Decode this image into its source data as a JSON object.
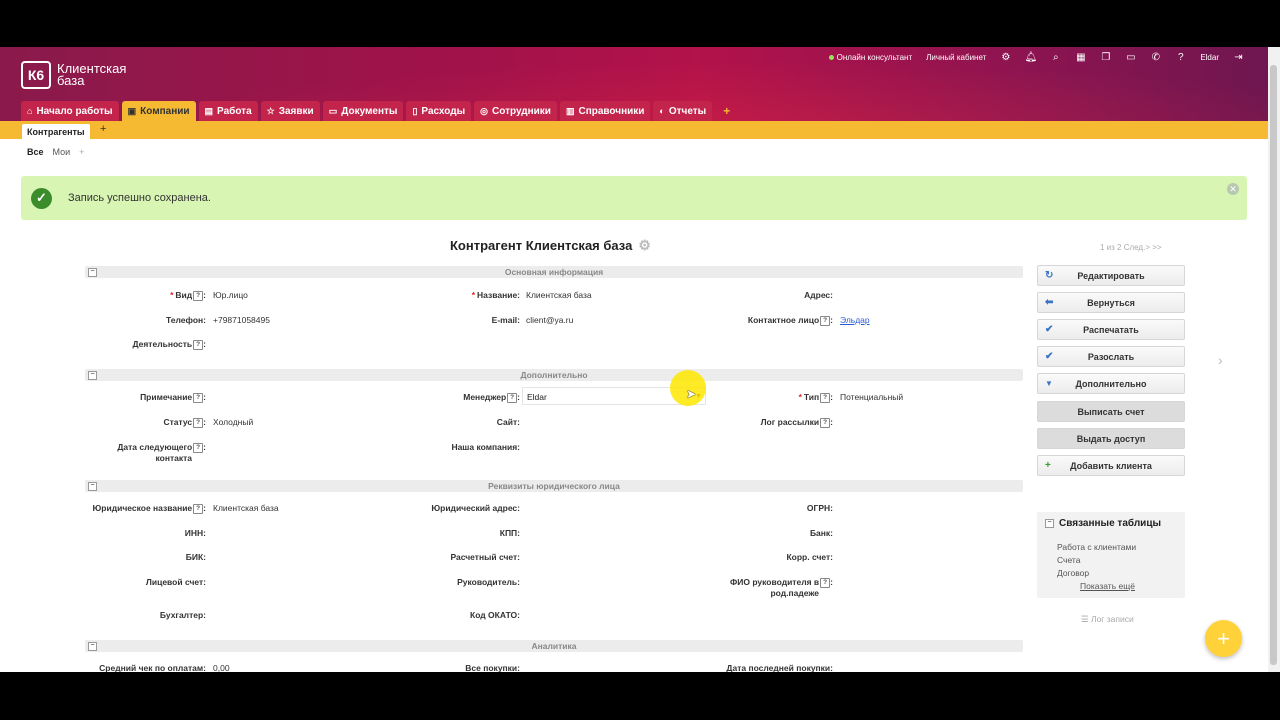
{
  "brand": {
    "logo_mark": "К6",
    "name_line1": "Клиентская",
    "name_line2": "база"
  },
  "header": {
    "online": "Онлайн консультант",
    "cabinet": "Личный кабинет",
    "user": "Eldar",
    "icons": [
      "gear-icon",
      "bell-icon",
      "search-icon",
      "calendar-icon",
      "chat-icon",
      "box-icon",
      "phone-icon",
      "help-icon"
    ]
  },
  "tabs": [
    {
      "label": "Начало работы",
      "icon": "⌂"
    },
    {
      "label": "Компании",
      "icon": "▣",
      "active": true
    },
    {
      "label": "Работа",
      "icon": "▤"
    },
    {
      "label": "Заявки",
      "icon": "☆"
    },
    {
      "label": "Документы",
      "icon": "▭"
    },
    {
      "label": "Расходы",
      "icon": "▯"
    },
    {
      "label": "Сотрудники",
      "icon": "◎"
    },
    {
      "label": "Справочники",
      "icon": "▥"
    },
    {
      "label": "Отчеты",
      "icon": "◐"
    }
  ],
  "tab_plus": "+",
  "subtab": {
    "label": "Контрагенты",
    "plus": "+"
  },
  "filters": {
    "all": "Все",
    "mine": "Мои",
    "plus": "+"
  },
  "alert": {
    "message": "Запись успешно сохранена."
  },
  "page": {
    "title": "Контрагент Клиентская база",
    "pager": "1 из 2 След.> >>"
  },
  "sections": {
    "basic": "Основная информация",
    "extra": "Дополнительно",
    "legal": "Реквизиты юридического лица",
    "analytics": "Аналитика"
  },
  "fields": {
    "vid_label": "Вид",
    "vid_value": "Юр.лицо",
    "name_label": "Название:",
    "name_value": "Клиентская база",
    "address_label": "Адрес:",
    "phone_label": "Телефон:",
    "phone_value": "+79871058495",
    "email_label": "E-mail:",
    "email_value": "client@ya.ru",
    "contact_label": "Контактное лицо",
    "contact_value": "Эльдар",
    "activity_label": "Деятельность",
    "note_label": "Примечание",
    "manager_label": "Менеджер",
    "manager_value": "Eldar",
    "type_label": "Тип",
    "type_value": "Потенциальный",
    "status_label": "Статус",
    "status_value": "Холодный",
    "site_label": "Сайт:",
    "maillog_label": "Лог рассылки",
    "nextdate_label1": "Дата следующего",
    "nextdate_label2": "контакта",
    "ourcompany_label": "Наша компания:",
    "legalname_label": "Юридическое название",
    "legalname_value": "Клиентская база",
    "legaladdr_label": "Юридический адрес:",
    "ogrn_label": "ОГРН:",
    "inn_label": "ИНН:",
    "kpp_label": "КПП:",
    "bank_label": "Банк:",
    "bik_label": "БИК:",
    "account_label": "Расчетный счет:",
    "corr_label": "Корр. счет:",
    "personal_label": "Лицевой счет:",
    "head_label": "Руководитель:",
    "headfio_label1": "ФИО руководителя в",
    "headfio_label2": "род.падеже",
    "accountant_label": "Бухгалтер:",
    "okato_label": "Код ОКАТО:",
    "avgcheck_label": "Средний чек по оплатам:",
    "avgcheck_value": "0,00",
    "purchases_label": "Все покупки:",
    "lastpurchase_label": "Дата последней покупки:"
  },
  "buttons": {
    "edit": "Редактировать",
    "back": "Вернуться",
    "print": "Распечатать",
    "send": "Разослать",
    "more": "Дополнительно",
    "invoice": "Выписать счет",
    "access": "Выдать доступ",
    "add_client": "Добавить клиента"
  },
  "related": {
    "title": "Связанные таблицы",
    "items": [
      "Работа с клиентами",
      "Счета",
      "Договор"
    ],
    "more": "Показать ещё"
  },
  "log": "Лог записи",
  "fab": "+",
  "colors": {
    "header": "#a0124a",
    "tab": "#c2244c",
    "accent": "#f5b932",
    "success_bg": "#d8f5b4",
    "success_icon": "#3b8c2a",
    "link": "#2a5bd7"
  }
}
